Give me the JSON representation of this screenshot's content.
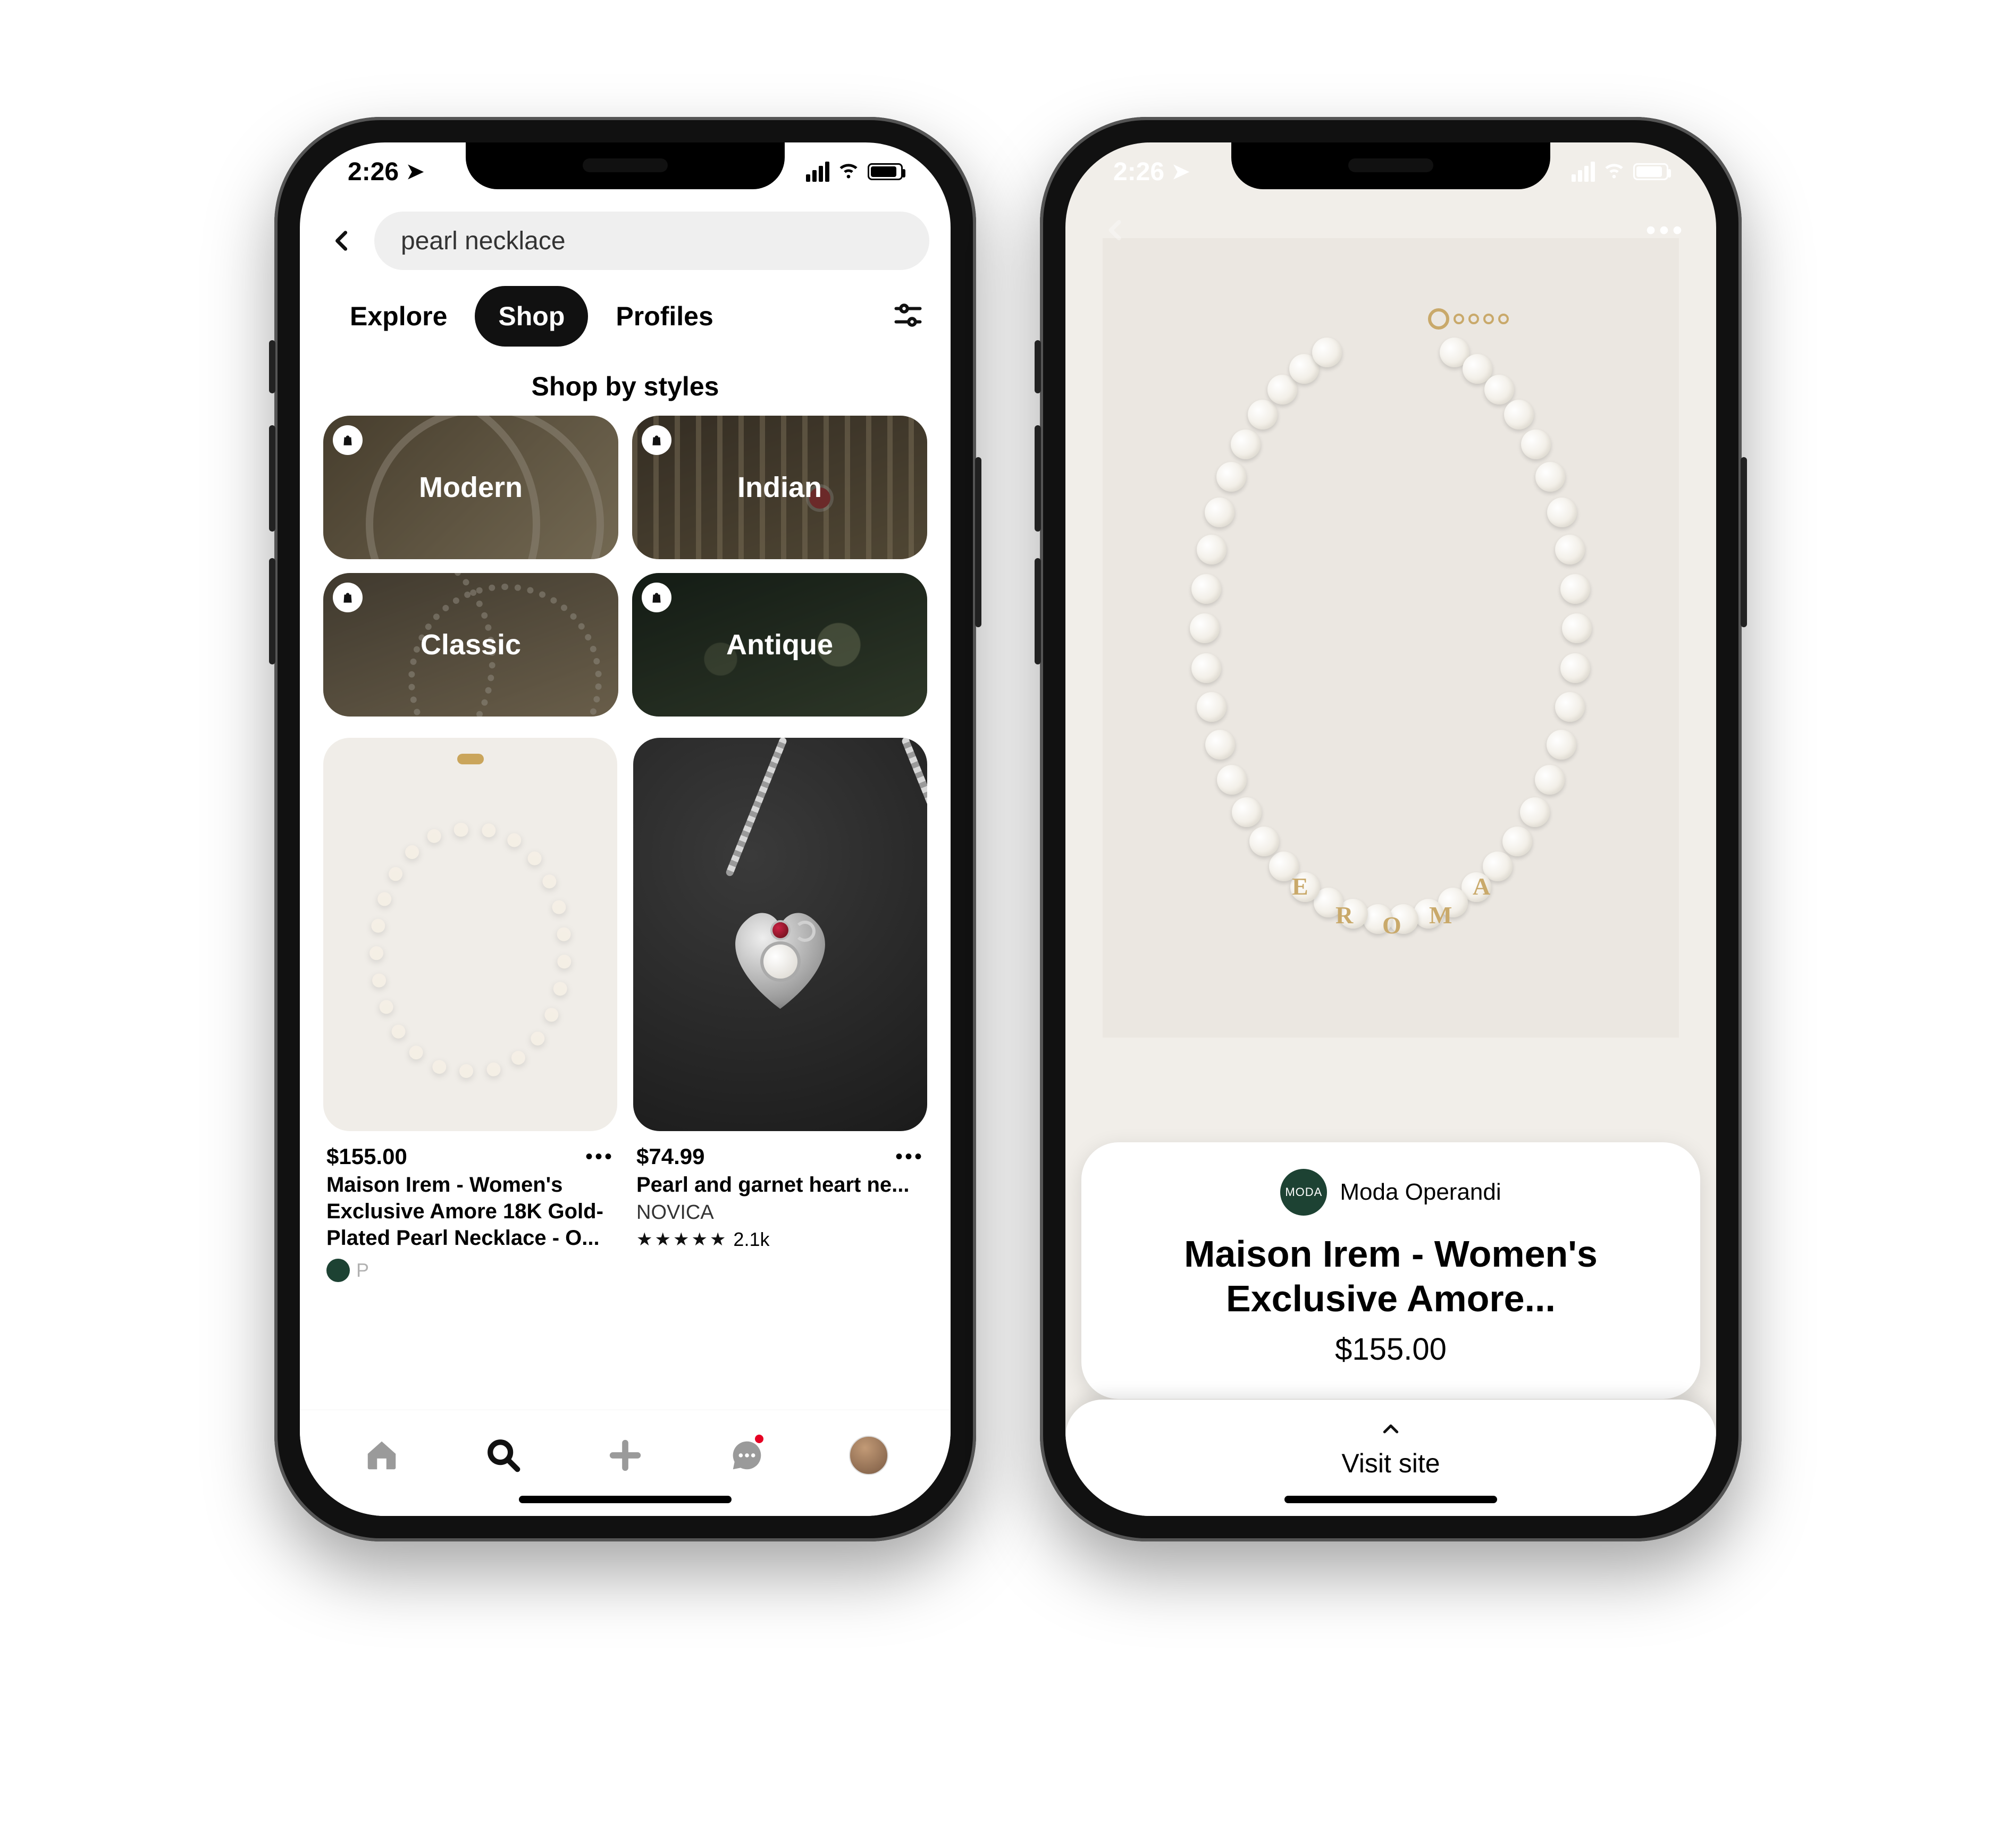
{
  "status": {
    "time": "2:26"
  },
  "left": {
    "search_query": "pearl necklace",
    "tabs": {
      "explore": "Explore",
      "shop": "Shop",
      "profiles": "Profiles",
      "active": "shop"
    },
    "section_title": "Shop by styles",
    "styles": [
      {
        "label": "Modern"
      },
      {
        "label": "Indian"
      },
      {
        "label": "Classic"
      },
      {
        "label": "Antique"
      }
    ],
    "products": [
      {
        "price": "$155.00",
        "title": "Maison Irem - Women's Exclusive Amore 18K Gold-Plated Pearl Necklace - O...",
        "promoted_partial": "P"
      },
      {
        "price": "$74.99",
        "title": "Pearl and garnet heart ne...",
        "brand": "NOVICA",
        "reviews": "2.1k"
      }
    ]
  },
  "detail": {
    "merchant": {
      "name": "Moda Operandi",
      "badge": "MODA"
    },
    "title": "Maison Irem - Women's Exclusive Amore...",
    "price": "$155.00",
    "cta": "Visit site",
    "letters": [
      "A",
      "M",
      "O",
      "R",
      "E"
    ]
  }
}
